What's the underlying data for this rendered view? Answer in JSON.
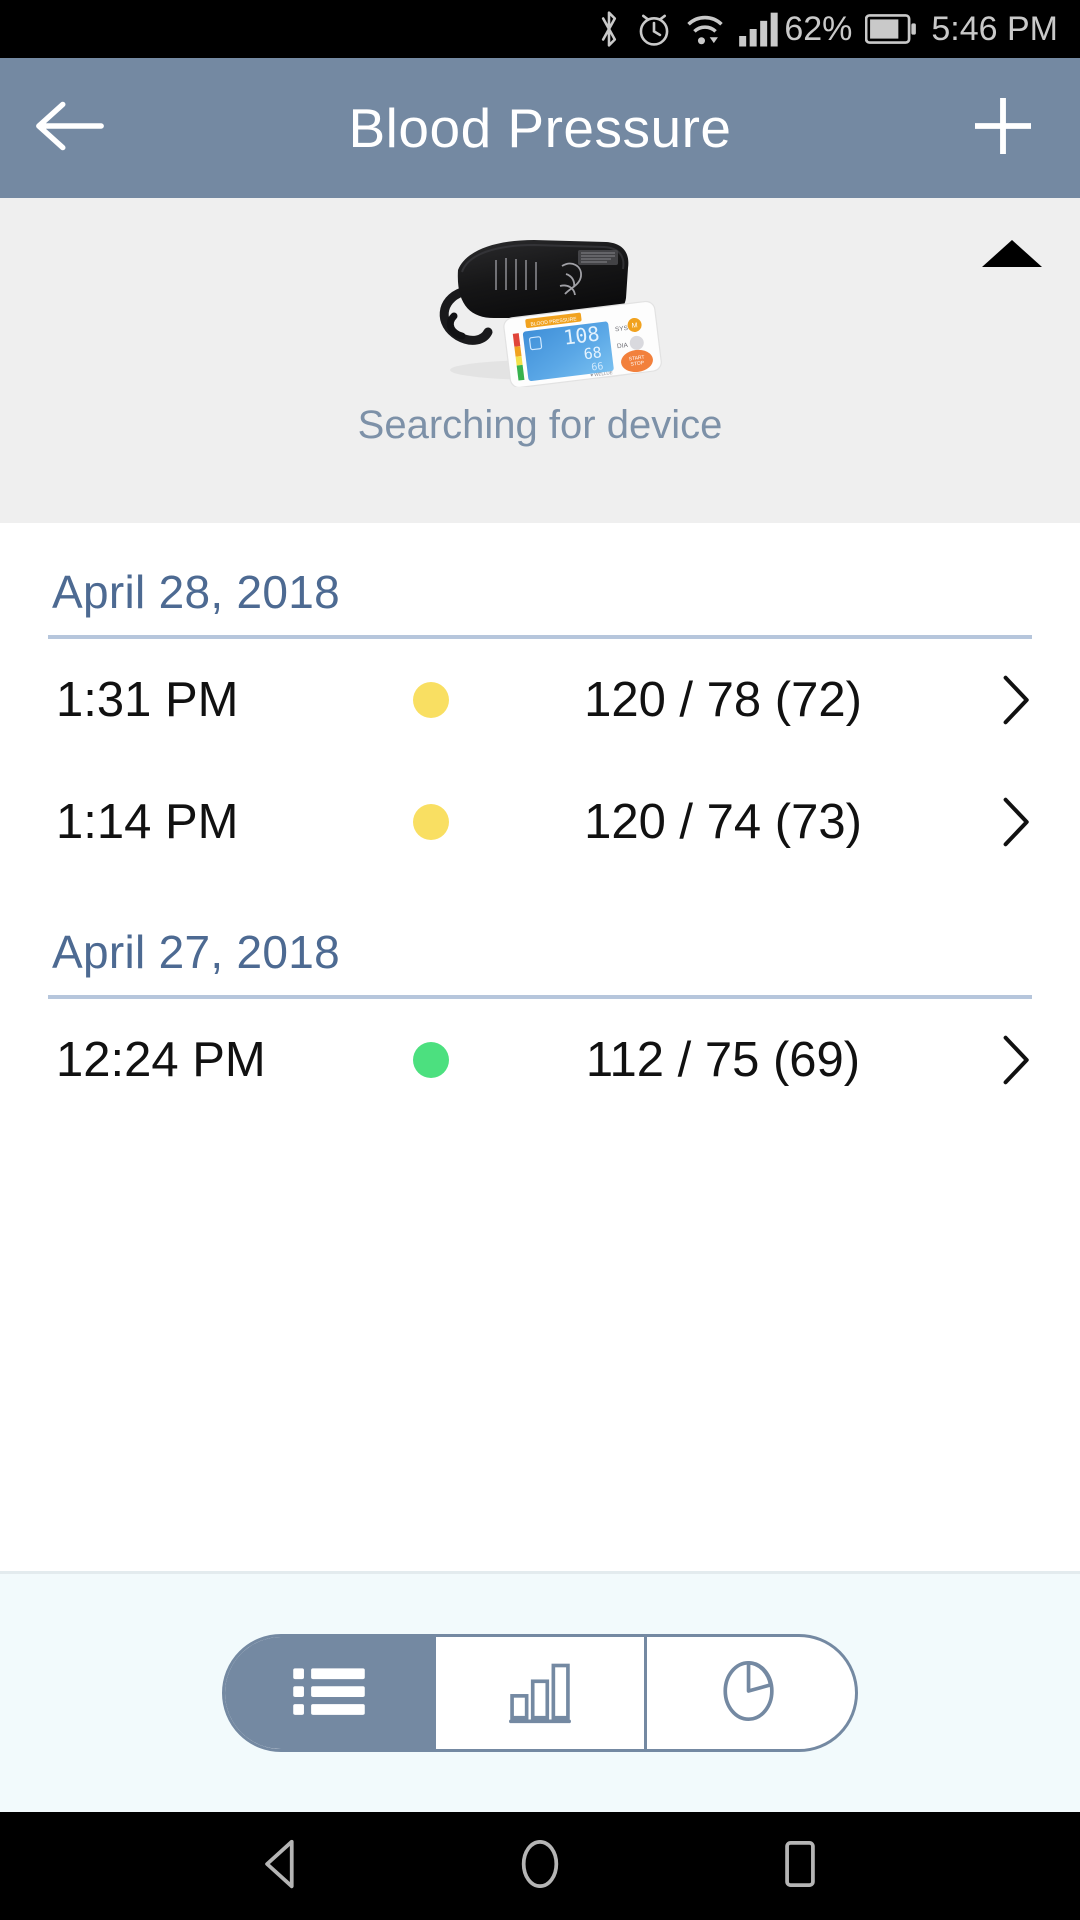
{
  "status_bar": {
    "icons": [
      "bluetooth-icon",
      "alarm-icon",
      "wifi-icon",
      "signal-icon",
      "battery-icon"
    ],
    "battery_percent": "62%",
    "clock": "5:46 PM"
  },
  "app_bar": {
    "back_icon": "arrow-left-icon",
    "title": "Blood Pressure",
    "add_icon": "plus-icon"
  },
  "device_panel": {
    "collapse_icon": "caret-up-icon",
    "device_image_alt": "blood-pressure-monitor-image",
    "status_text": "Searching for device",
    "background": "#efefef",
    "status_color": "#7d91a8"
  },
  "readings": {
    "groups": [
      {
        "date": "April 28, 2018",
        "rows": [
          {
            "time": "1:31 PM",
            "dot_color": "#f9df62",
            "value": "120 / 78 (72)",
            "chevron": "chevron-right-icon"
          },
          {
            "time": "1:14 PM",
            "dot_color": "#f9df62",
            "value": "120 / 74 (73)",
            "chevron": "chevron-right-icon"
          }
        ]
      },
      {
        "date": "April 27, 2018",
        "rows": [
          {
            "time": "12:24 PM",
            "dot_color": "#4ce07f",
            "value": "112 / 75 (69)",
            "chevron": "chevron-right-icon"
          }
        ]
      }
    ]
  },
  "tab_bar": {
    "segments": [
      {
        "name": "list-view",
        "icon": "list-icon",
        "active": true
      },
      {
        "name": "bar-chart-view",
        "icon": "bar-chart-icon",
        "active": false
      },
      {
        "name": "pie-chart-view",
        "icon": "pie-chart-icon",
        "active": false
      }
    ],
    "accent_color": "#7489a2",
    "background": "#f2fafc"
  },
  "nav_bar": {
    "buttons": [
      "back-triangle-icon",
      "home-circle-icon",
      "recents-square-icon"
    ]
  },
  "theme": {
    "appbar_color": "#7489a2",
    "date_header_color": "#4d6a92",
    "rule_color": "#b6c6dc"
  }
}
